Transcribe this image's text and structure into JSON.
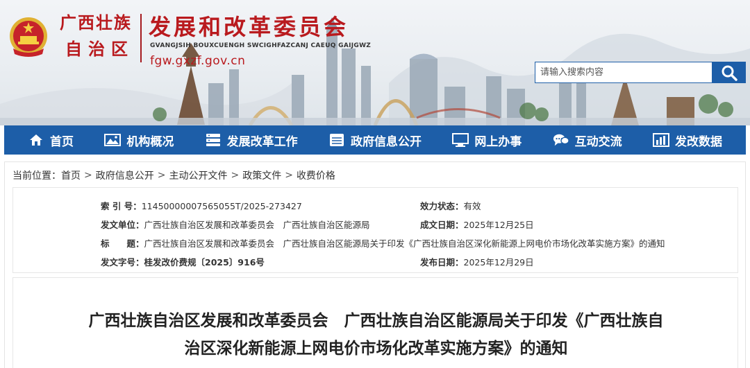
{
  "header": {
    "region_line1": "广西壮族",
    "region_line2": "自治区",
    "org_name": "发展和改革委员会",
    "org_name_zhuang": "GVANGJSIH BOUXCUENGH SWCIGHFAZCANJ CAEUQ GAIJGWZ",
    "site_url": "fgw.gxzf.gov.cn"
  },
  "search": {
    "placeholder": "请输入搜索内容",
    "icon": "search-icon"
  },
  "nav": {
    "items": [
      {
        "label": "首页",
        "icon": "home-icon"
      },
      {
        "label": "机构概况",
        "icon": "image-icon"
      },
      {
        "label": "发展改革工作",
        "icon": "server-icon"
      },
      {
        "label": "政府信息公开",
        "icon": "database-icon"
      },
      {
        "label": "网上办事",
        "icon": "monitor-icon"
      },
      {
        "label": "互动交流",
        "icon": "chat-icon"
      },
      {
        "label": "发改数据",
        "icon": "bar-chart-icon"
      }
    ]
  },
  "breadcrumb": {
    "prefix": "当前位置：",
    "items": [
      "首页",
      "政府信息公开",
      "主动公开文件",
      "政策文件",
      "收费价格"
    ],
    "separator": ">"
  },
  "meta": {
    "index_no_label": "索 引 号：",
    "index_no": "11450000007565055T/2025-273427",
    "status_label": "效力状态：",
    "status": "有效",
    "issuer_label": "发文单位：",
    "issuer": "广西壮族自治区发展和改革委员会　广西壮族自治区能源局",
    "created_label": "成文日期：",
    "created": "2025年12月25日",
    "title_label": "标　　题：",
    "title": "广西壮族自治区发展和改革委员会　广西壮族自治区能源局关于印发《广西壮族自治区深化新能源上网电价市场化改革实施方案》的通知",
    "doc_no_label": "发文字号：",
    "doc_no": "桂发改价费规〔2025〕916号",
    "published_label": "发布日期：",
    "published": "2025年12月29日"
  },
  "article": {
    "title_line1": "广西壮族自治区发展和改革委员会　广西壮族自治区能源局关于印发《广西壮族自",
    "title_line2": "治区深化新能源上网电价市场化改革实施方案》的通知"
  },
  "colors": {
    "nav_bg": "#1d5ea8",
    "brand_red": "#b91a1e",
    "text": "#333333"
  }
}
